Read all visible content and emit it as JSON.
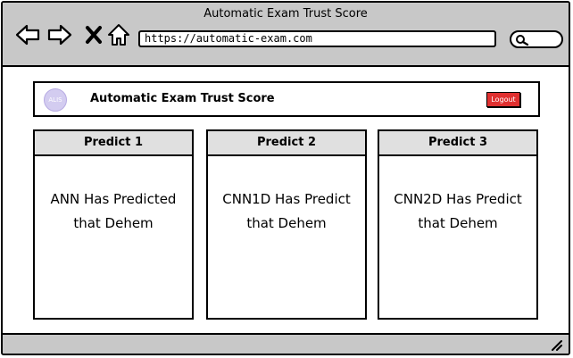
{
  "browser": {
    "title": "Automatic Exam Trust Score",
    "url": "https://automatic-exam.com",
    "icons": [
      "back-arrow-icon",
      "forward-arrow-icon",
      "close-icon",
      "home-icon",
      "search-icon",
      "resize-icon"
    ]
  },
  "header": {
    "logo_text": "ALIS",
    "app_name": "Automatic Exam Trust Score",
    "logout_label": "Logout",
    "logout_color": "#e03030"
  },
  "panels": [
    {
      "title": "Predict 1",
      "line1": "ANN Has Predicted",
      "line2": "that Dehem"
    },
    {
      "title": "Predict 2",
      "line1": "CNN1D Has Predict",
      "line2": "that Dehem"
    },
    {
      "title": "Predict 3",
      "line1": "CNN2D Has Predict",
      "line2": "that Dehem"
    }
  ]
}
